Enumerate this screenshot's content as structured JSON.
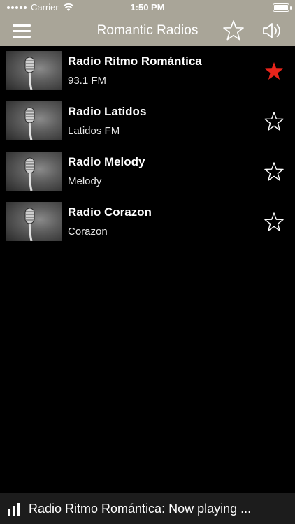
{
  "status_bar": {
    "carrier": "Carrier",
    "time": "1:50 PM"
  },
  "nav": {
    "title": "Romantic Radios",
    "star_icon": "star-outline-icon",
    "speaker_icon": "speaker-icon",
    "menu_icon": "hamburger-menu-icon"
  },
  "colors": {
    "nav_bg": "#a9a598",
    "favorite_active": "#e8241b",
    "background": "#000000"
  },
  "stations": [
    {
      "name": "Radio Ritmo Romántica",
      "subtitle": "93.1 FM",
      "favorite": true
    },
    {
      "name": "Radio Latidos",
      "subtitle": "Latidos FM",
      "favorite": false
    },
    {
      "name": "Radio Melody",
      "subtitle": "Melody",
      "favorite": false
    },
    {
      "name": "Radio Corazon",
      "subtitle": "Corazon",
      "favorite": false
    }
  ],
  "player": {
    "now_playing": "Radio Ritmo Romántica: Now playing ..."
  }
}
